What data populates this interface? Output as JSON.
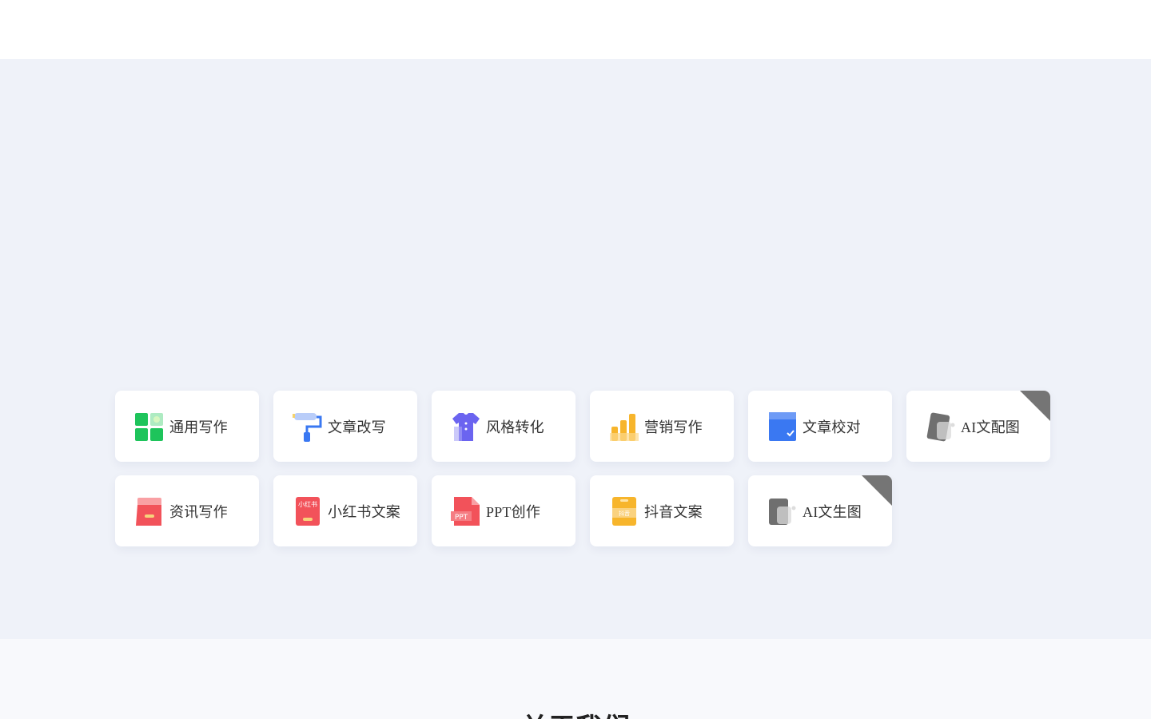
{
  "tools": [
    {
      "label": "通用写作",
      "icon": "grid-blocks-icon",
      "color": "#1ec45b",
      "corner": false
    },
    {
      "label": "文章改写",
      "icon": "paint-roller-icon",
      "color": "#3a78f2",
      "corner": false
    },
    {
      "label": "风格转化",
      "icon": "shirt-icon",
      "color": "#6b64f0",
      "corner": false
    },
    {
      "label": "营销写作",
      "icon": "bar-chart-icon",
      "color": "#f7b52c",
      "corner": false
    },
    {
      "label": "文章校对",
      "icon": "checked-document-icon",
      "color": "#3a78f2",
      "corner": false
    },
    {
      "label": "AI文配图",
      "icon": "ai-image-icon",
      "color": "#6f6f6f",
      "corner": true
    },
    {
      "label": "资讯写作",
      "icon": "news-folder-icon",
      "color": "#f2525a",
      "corner": false
    },
    {
      "label": "小红书文案",
      "icon": "xiaohongshu-icon",
      "color": "#f2525a",
      "corner": false,
      "badge": "小红书"
    },
    {
      "label": "PPT创作",
      "icon": "ppt-file-icon",
      "color": "#f2525a",
      "corner": false,
      "badge": "PPT"
    },
    {
      "label": "抖音文案",
      "icon": "douyin-phone-icon",
      "color": "#f7b52c",
      "corner": false,
      "badge": "抖音"
    },
    {
      "label": "AI文生图",
      "icon": "ai-image-icon",
      "color": "#6f6f6f",
      "corner": true
    }
  ],
  "about": {
    "title": "关于我们"
  }
}
